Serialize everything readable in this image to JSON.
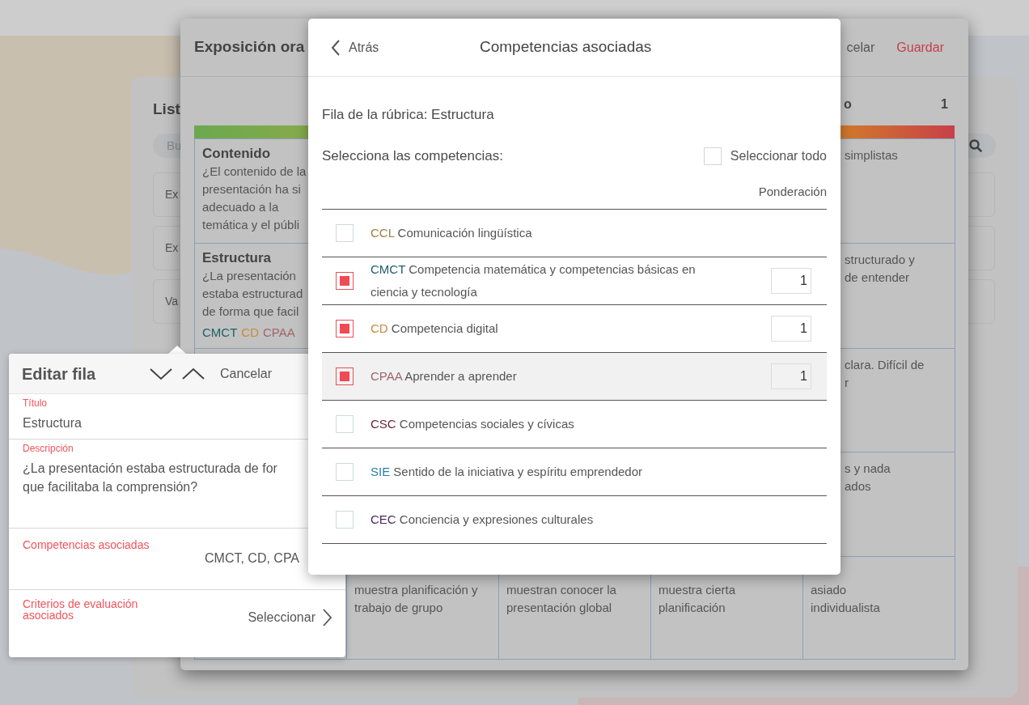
{
  "background": {
    "list_title": "List",
    "search_placeholder": "Bu",
    "items": [
      "Ex",
      "Ex",
      "Va"
    ]
  },
  "dialog": {
    "title": "Exposición ora",
    "cancel": "celar",
    "save": "Guardar",
    "last_column_header": "o",
    "last_column_score": "1",
    "rows": [
      {
        "title": "Contenido",
        "description": "¿El contenido de la\npresentación ha si\nadecuado a la\ntemática y el públi",
        "column_5": "simplistas"
      },
      {
        "title": "Estructura",
        "description": "¿La presentación\nestaba estructurad\nde forma que facil",
        "tags": [
          {
            "code": "CMCT",
            "color": "#1f6066"
          },
          {
            "code": "CD",
            "color": "#c98a3a"
          },
          {
            "code": "CPAA",
            "color": "#a0656c"
          }
        ],
        "column_5": "structurado y\nde entender"
      },
      {
        "column_5": "clara. Difícil de\nr"
      },
      {
        "column_5": "s y nada\nados"
      },
      {
        "column_2": "muestra planificación y\ntrabajo de grupo",
        "column_3": "muestran conocer la\npresentación global",
        "column_4": "muestra cierta\nplanificación",
        "column_5": "asiado\nindividualista"
      }
    ]
  },
  "edit_row": {
    "title": "Editar fila",
    "cancel": "Cancelar",
    "fields": [
      {
        "kind": "text",
        "label": "Título",
        "value": "Estructura"
      },
      {
        "kind": "textarea",
        "label": "Descripción",
        "value": "¿La presentación estaba estructurada de for\nque facilitaba la comprensión?"
      },
      {
        "kind": "summary",
        "label": "Competencias asociadas",
        "value": "CMCT, CD, CPA"
      },
      {
        "kind": "link",
        "label": "Criterios de evaluación\nasociados",
        "value": "Seleccionar"
      }
    ]
  },
  "competencies_modal": {
    "back": "Atrás",
    "title": "Competencias asociadas",
    "row_label": "Fila de la rúbrica: Estructura",
    "select_label": "Selecciona las competencias:",
    "select_all": {
      "label": "Seleccionar todo",
      "checked": false
    },
    "weight_header": "Ponderación",
    "competencies": [
      {
        "code": "CCL",
        "name": "Comunicación lingüística",
        "color": "#9b8040",
        "checked": false,
        "highlighted": false
      },
      {
        "code": "CMCT",
        "name": "Competencia matemática y competencias básicas en ciencia y tecnología",
        "color": "#1f6066",
        "checked": true,
        "highlighted": false,
        "weight": "1"
      },
      {
        "code": "CD",
        "name": "Competencia digital",
        "color": "#c98a3a",
        "checked": true,
        "highlighted": false,
        "weight": "1"
      },
      {
        "code": "CPAA",
        "name": "Aprender a aprender",
        "color": "#a0656c",
        "checked": true,
        "highlighted": true,
        "weight": "1"
      },
      {
        "code": "CSC",
        "name": "Competencias sociales y cívicas",
        "color": "#6b1f3c",
        "checked": false,
        "highlighted": false
      },
      {
        "code": "SIE",
        "name": "Sentido de la iniciativa y espíritu emprendedor",
        "color": "#2a7fa8",
        "checked": false,
        "highlighted": false
      },
      {
        "code": "CEC",
        "name": "Conciencia y expresiones culturales",
        "color": "#4b2a5c",
        "checked": false,
        "highlighted": false
      }
    ]
  }
}
